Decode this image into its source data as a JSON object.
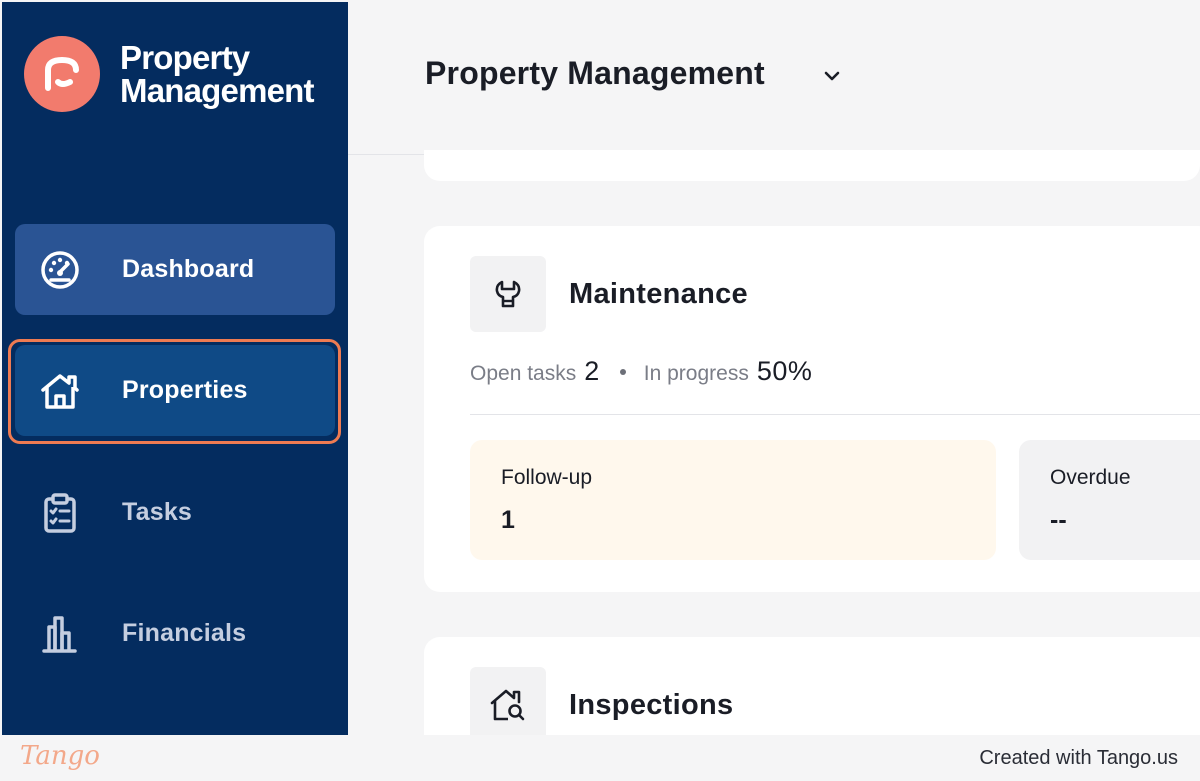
{
  "brand": {
    "line1": "Property",
    "line2": "Management",
    "logo_icon": "brand-logo-icon"
  },
  "sidebar": {
    "items": [
      {
        "label": "Dashboard",
        "icon": "gauge-icon",
        "state": "hover"
      },
      {
        "label": "Properties",
        "icon": "house-icon",
        "state": "active"
      },
      {
        "label": "Tasks",
        "icon": "clipboard-icon",
        "state": "default"
      },
      {
        "label": "Financials",
        "icon": "building-chart-icon",
        "state": "default"
      }
    ]
  },
  "header": {
    "title": "Property Management",
    "chevron": "chevron-down-icon"
  },
  "maintenance": {
    "title": "Maintenance",
    "icon": "wrench-icon",
    "open_tasks_label": "Open tasks",
    "open_tasks_value": "2",
    "in_progress_label": "In progress",
    "in_progress_value": "50%",
    "followup": {
      "label": "Follow-up",
      "value": "1"
    },
    "overdue": {
      "label": "Overdue",
      "value": "--"
    }
  },
  "inspections": {
    "title": "Inspections",
    "icon": "house-search-icon"
  },
  "footer": {
    "logo": "Tango",
    "credit": "Created with Tango.us"
  },
  "colors": {
    "sidebar_bg": "#042c5f",
    "nav_hover_bg": "#2a5494",
    "nav_active_bg": "#0f4a86",
    "highlight_border": "#ee7b52",
    "brand_accent": "#f27b6d",
    "followup_bg": "#fff8ed"
  }
}
